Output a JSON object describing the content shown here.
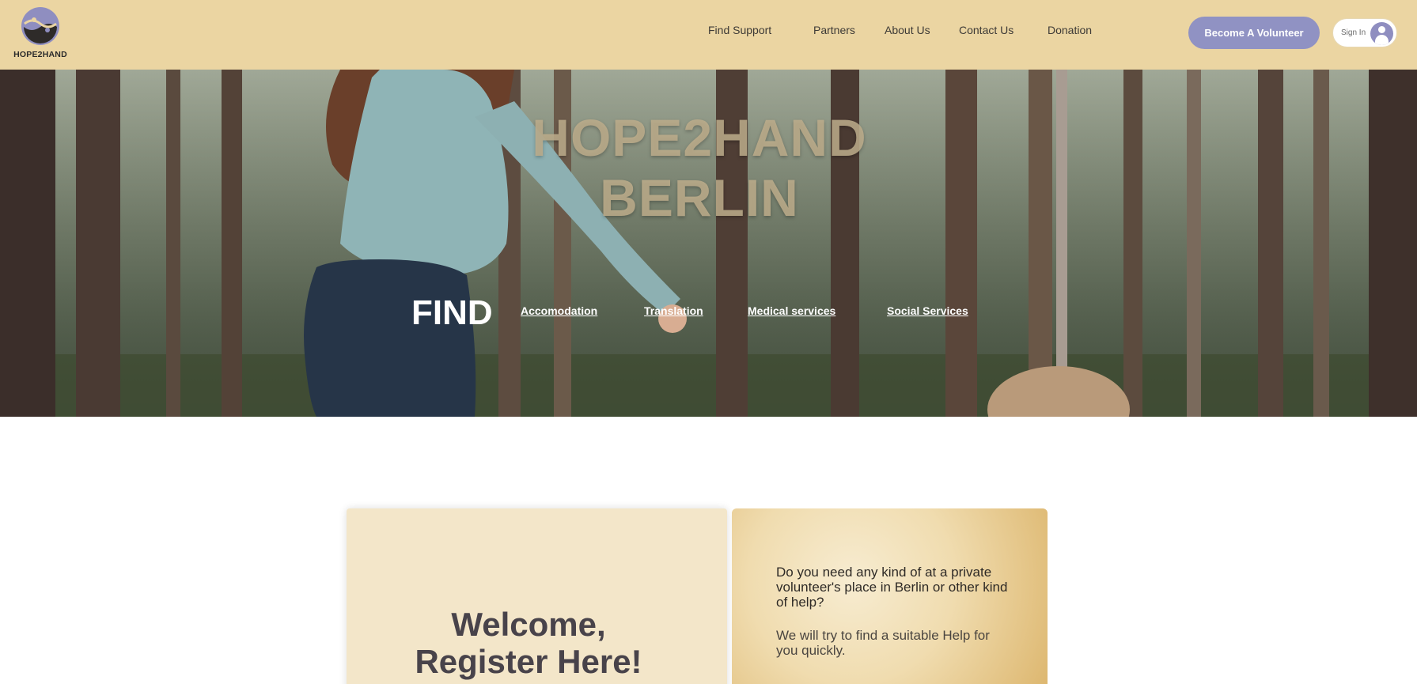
{
  "header": {
    "logo_text": "HOPE2HAND",
    "nav": [
      "Find Support",
      "Partners",
      "About Us",
      "Contact Us",
      "Donation"
    ],
    "volunteer_button": "Become A Volunteer",
    "signin_label": "Sign In"
  },
  "hero": {
    "title_line1": "HOPE2HAND",
    "title_line2": "BERLIN",
    "find_label": "FIND",
    "links": [
      "Accomodation",
      "Translation",
      "Medical services",
      "Social Services"
    ]
  },
  "register": {
    "welcome_line1": "Welcome,",
    "welcome_line2": "Register Here!",
    "question": "Do you need any kind of at a private volunteer's place in Berlin or other kind of help?",
    "answer": "We will try to find a suitable Help for you quickly."
  },
  "colors": {
    "header_bg": "#ebd5a2",
    "accent_purple": "#9092c3",
    "card_left_bg": "#f3e6c9",
    "card_right_gold": "#dcb56c"
  },
  "icons": [
    "logo-icon",
    "user-avatar-icon"
  ]
}
